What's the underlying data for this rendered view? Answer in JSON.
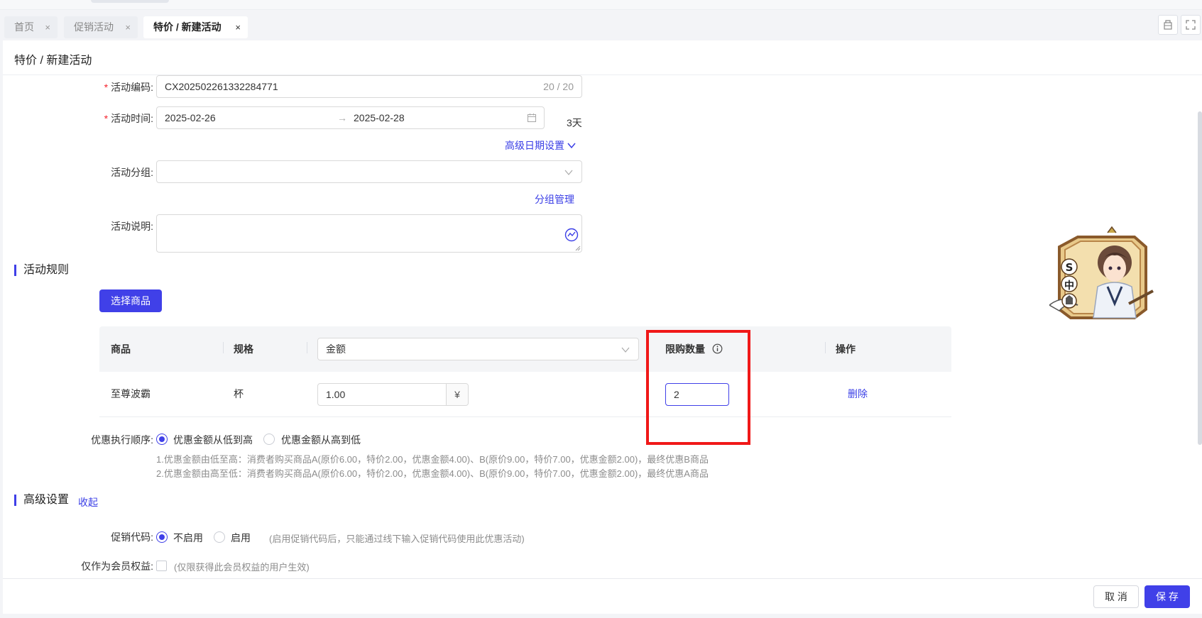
{
  "tabs": [
    {
      "label": "首页",
      "close": "×"
    },
    {
      "label": "促销活动",
      "close": "×"
    },
    {
      "label": "特价 / 新建活动",
      "close": "×"
    }
  ],
  "page": {
    "title": "特价 / 新建活动"
  },
  "form": {
    "code_label": "活动编码:",
    "code_value": "CX202502261332284771",
    "code_count": "20 / 20",
    "time_label": "活动时间:",
    "start_date": "2025-02-26",
    "end_date": "2025-02-28",
    "range_arrow": "→",
    "days": "3天",
    "advanced_date": "高级日期设置",
    "group_label": "活动分组:",
    "group_manage": "分组管理",
    "desc_label": "活动说明:"
  },
  "rules": {
    "section_title": "活动规则",
    "select_goods_button": "选择商品",
    "table": {
      "headers": {
        "goods": "商品",
        "spec": "规格",
        "amount_select": "金额",
        "limit": "限购数量",
        "action": "操作"
      },
      "rows": [
        {
          "goods": "至尊波霸",
          "spec": "杯",
          "amount": "1.00",
          "currency": "¥",
          "limit": "2",
          "action": "删除"
        }
      ]
    },
    "order_label": "优惠执行顺序:",
    "order_options": [
      "优惠金额从低到高",
      "优惠金额从高到低"
    ],
    "order_selected": 0,
    "hint_1": "1.优惠金额由低至高：消费者购买商品A(原价6.00，特价2.00，优惠金额4.00)、B(原价9.00，特价7.00，优惠金额2.00)，最终优惠B商品",
    "hint_2": "2.优惠金额由高至低：消费者购买商品A(原价6.00，特价2.00，优惠金额4.00)、B(原价9.00，特价7.00，优惠金额2.00)，最终优惠A商品"
  },
  "advanced": {
    "section_title": "高级设置",
    "collapse_link": "收起",
    "promo_code_label": "促销代码:",
    "promo_options": [
      "不启用",
      "启用"
    ],
    "promo_selected": 0,
    "promo_hint": "(启用促销代码后，只能通过线下输入促销代码使用此优惠活动)",
    "member_label": "仅作为会员权益:",
    "member_hint": "(仅限获得此会员权益的用户生效)"
  },
  "footer": {
    "cancel": "取 消",
    "save": "保 存"
  },
  "mascot": {
    "letters": [
      "S",
      "中"
    ]
  },
  "colors": {
    "primary": "#4040e8",
    "danger": "#f01818",
    "required": "#f5222d"
  }
}
